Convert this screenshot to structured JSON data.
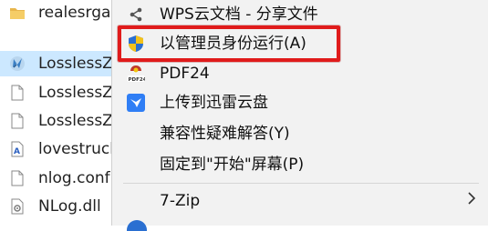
{
  "files": [
    {
      "name": "realesrgan",
      "icon": "folder-icon"
    },
    {
      "name": "LosslessZo",
      "icon": "app-exe-icon",
      "selected": true
    },
    {
      "name": "LosslessZo",
      "icon": "document-icon"
    },
    {
      "name": "LosslessZo",
      "icon": "document-icon"
    },
    {
      "name": "lovestruck",
      "icon": "text-file-icon"
    },
    {
      "name": "nlog.conf",
      "icon": "document-icon"
    },
    {
      "name": "NLog.dll",
      "icon": "dll-file-icon"
    }
  ],
  "menu": {
    "items": [
      {
        "label": "WPS云文档 - 分享文件",
        "icon": "share-icon"
      },
      {
        "label": "以管理员身份运行(A)",
        "icon": "shield-icon",
        "highlighted": true
      },
      {
        "label": "PDF24",
        "icon": "pdf24-icon"
      },
      {
        "label": "上传到迅雷云盘",
        "icon": "thunder-cloud-icon"
      },
      {
        "label": "兼容性疑难解答(Y)",
        "icon": ""
      },
      {
        "label": "固定到\"开始\"屏幕(P)",
        "icon": ""
      },
      {
        "label": "7-Zip",
        "icon": "",
        "has_submenu": true
      }
    ]
  },
  "colors": {
    "highlight_border": "#e01b1b",
    "selected_row": "#cce8ff",
    "menu_bg": "#f2f2f2"
  }
}
